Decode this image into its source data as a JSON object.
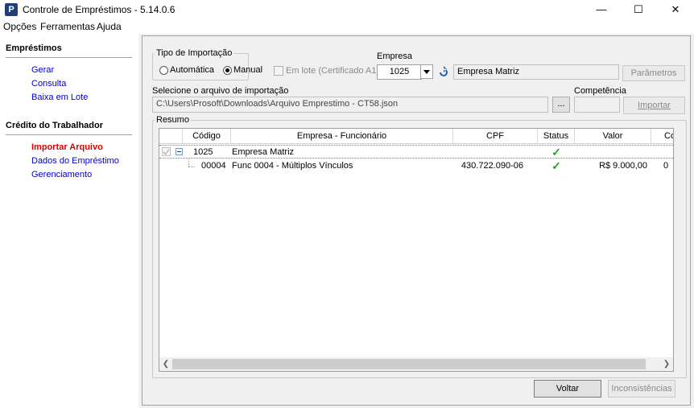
{
  "window": {
    "app_icon": "P",
    "title": "Controle de Empréstimos - 5.14.0.6",
    "minimize": "—",
    "maximize": "☐",
    "close": "✕"
  },
  "menu": [
    "Opções",
    "Ferramentas",
    "Ajuda"
  ],
  "sidebar": {
    "sections": [
      {
        "title": "Empréstimos",
        "links": [
          "Gerar",
          "Consulta",
          "Baixa em Lote"
        ]
      },
      {
        "title": "Crédito do Trabalhador",
        "links": [
          "Importar Arquivo",
          "Dados do Empréstimo",
          "Gerenciamento"
        ],
        "active": "Importar Arquivo"
      }
    ]
  },
  "import": {
    "tipo_label": "Tipo de Importação",
    "radio_auto": "Automática",
    "radio_manual": "Manual",
    "selected": "Manual",
    "lote_label": "Em lote (Certificado A1)",
    "empresa_label": "Empresa",
    "empresa_code": "1025",
    "empresa_name": "Empresa Matriz",
    "parametros_button": "Parâmetros",
    "file_label": "Selecione o arquivo de importação",
    "file_path": "C:\\Users\\Prosoft\\Downloads\\Arquivo Emprestimo - CT58.json",
    "browse_button": "...",
    "competencia_label": "Competência",
    "competencia_value": "",
    "importar_button": "Importar"
  },
  "resumo": {
    "label": "Resumo",
    "columns": [
      "Código",
      "Empresa - Funcionário",
      "CPF",
      "Status",
      "Valor",
      "Cor"
    ],
    "rows": [
      {
        "codigo": "1025",
        "nome": "Empresa Matriz",
        "cpf": "",
        "status": "✓",
        "valor": "",
        "cor": ""
      },
      {
        "codigo": "00004",
        "nome": "Func 0004 - Múltiplos Vínculos",
        "cpf": "430.722.090-06",
        "status": "✓",
        "valor": "R$ 9.000,00",
        "cor": "0"
      }
    ]
  },
  "footer": {
    "voltar_button": "Voltar",
    "inconsistencias_button": "Inconsistências"
  },
  "colors": {
    "active_link": "#e00000",
    "link": "#0000cc",
    "check": "#2a9d2a"
  }
}
